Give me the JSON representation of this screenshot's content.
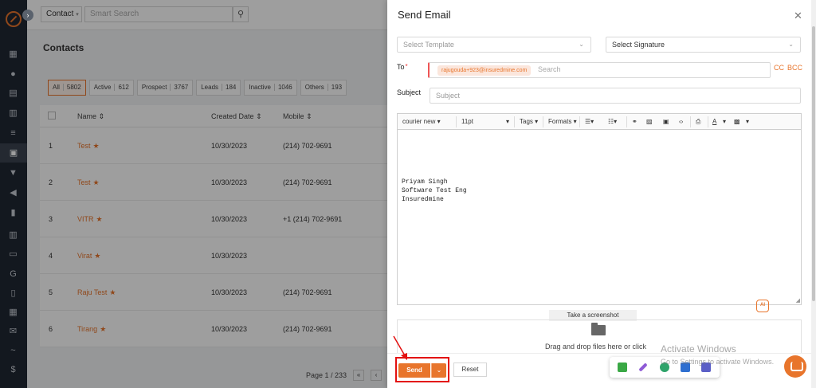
{
  "background": {
    "topbar": {
      "contact_select": "Contact",
      "search_placeholder": "Smart Search"
    },
    "page_title": "Contacts",
    "filters": [
      {
        "label": "All",
        "count": "5802"
      },
      {
        "label": "Active",
        "count": "612"
      },
      {
        "label": "Prospect",
        "count": "3767"
      },
      {
        "label": "Leads",
        "count": "184"
      },
      {
        "label": "Inactive",
        "count": "1046"
      },
      {
        "label": "Others",
        "count": "193"
      }
    ],
    "table": {
      "headers": {
        "name": "Name",
        "created": "Created Date",
        "mobile": "Mobile"
      },
      "rows": [
        {
          "num": "1",
          "name": "Test",
          "created": "10/30/2023",
          "mobile": "(214) 702-9691"
        },
        {
          "num": "2",
          "name": "Test",
          "created": "10/30/2023",
          "mobile": "(214) 702-9691"
        },
        {
          "num": "3",
          "name": "VITR",
          "created": "10/30/2023",
          "mobile": "+1 (214) 702-9691"
        },
        {
          "num": "4",
          "name": "Virat",
          "created": "10/30/2023",
          "mobile": ""
        },
        {
          "num": "5",
          "name": "Raju Test",
          "created": "10/30/2023",
          "mobile": "(214) 702-9691"
        },
        {
          "num": "6",
          "name": "Tirang",
          "created": "10/30/2023",
          "mobile": "(214) 702-9691"
        }
      ]
    },
    "pager": "Page 1 / 233"
  },
  "modal": {
    "title": "Send Email",
    "template_placeholder": "Select Template",
    "signature": "Select Signature",
    "to_label": "To",
    "to_chip": "rajugouda+923@insuredmine.com",
    "to_search": "Search",
    "cc": "CC",
    "bcc": "BCC",
    "subject_label": "Subject",
    "subject_placeholder": "Subject",
    "toolbar": {
      "font": "courier new",
      "size": "11pt",
      "tags": "Tags",
      "formats": "Formats",
      "text_color": "A"
    },
    "body_lines": [
      "Priyam Singh",
      "Software Test Eng",
      "Insuredmine"
    ],
    "ai_badge": "AI",
    "screenshot_button": "Take a screenshot",
    "drop_text": "Drag and drop files here or click",
    "send": "Send",
    "reset": "Reset"
  },
  "os": {
    "watermark_title": "Activate Windows",
    "watermark_sub": "Go to Settings to activate Windows."
  },
  "colors": {
    "accent": "#e8752c",
    "sidebar": "#1f2733",
    "highlight": "#e31010"
  }
}
